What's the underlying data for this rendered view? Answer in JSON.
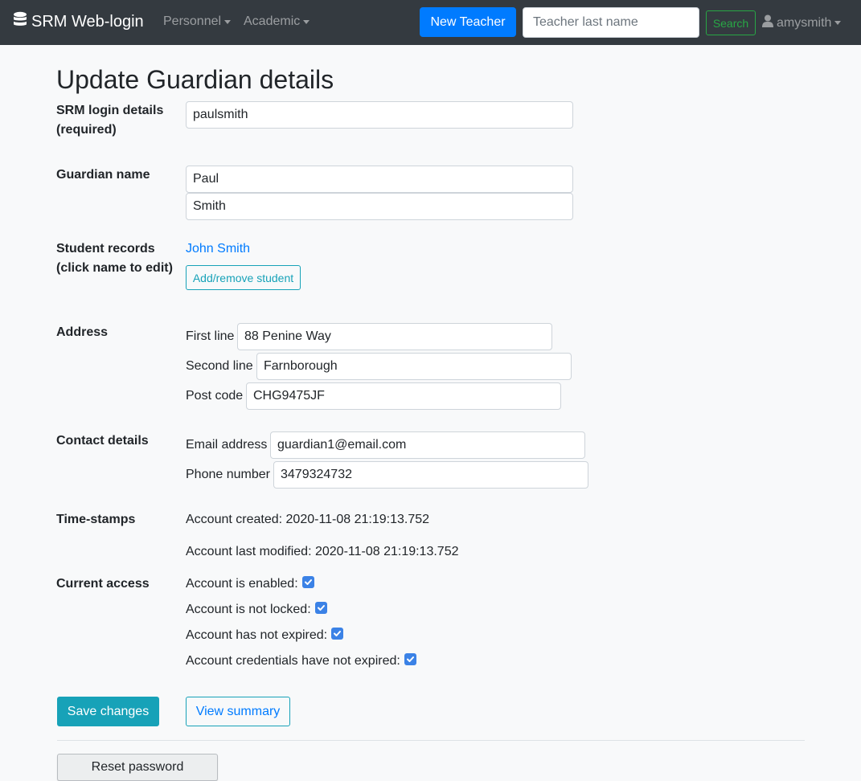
{
  "navbar": {
    "brand": "SRM Web-login",
    "menu_personnel": "Personnel",
    "menu_academic": "Academic",
    "new_teacher_label": "New Teacher",
    "search_placeholder": "Teacher last name",
    "search_label": "Search",
    "username": "amysmith",
    "brand_icon": "database-icon",
    "user_icon": "user-icon"
  },
  "page": {
    "title": "Update Guardian details"
  },
  "login": {
    "label": "SRM login details (required)",
    "username": "paulsmith"
  },
  "guardian": {
    "label": "Guardian name",
    "first_name": "Paul",
    "last_name": "Smith"
  },
  "students": {
    "label": "Student records (click name to edit)",
    "records": [
      "John Smith"
    ],
    "add_remove_label": "Add/remove student"
  },
  "address": {
    "label": "Address",
    "first_line_label": "First line",
    "first_line": "88 Penine Way",
    "second_line_label": "Second line",
    "second_line": "Farnborough",
    "post_code_label": "Post code",
    "post_code": "CHG9475JF"
  },
  "contact": {
    "label": "Contact details",
    "email_label": "Email address",
    "email": "guardian1@email.com",
    "phone_label": "Phone number",
    "phone": "3479324732"
  },
  "timestamps": {
    "label": "Time-stamps",
    "created": "Account created: 2020-11-08 21:19:13.752",
    "modified": "Account last modified: 2020-11-08 21:19:13.752"
  },
  "access": {
    "label": "Current access",
    "items": [
      {
        "text": "Account is enabled:",
        "checked": true
      },
      {
        "text": "Account is not locked:",
        "checked": true
      },
      {
        "text": "Account has not expired:",
        "checked": true
      },
      {
        "text": "Account credentials have not expired:",
        "checked": true
      }
    ]
  },
  "actions": {
    "save_label": "Save changes",
    "view_summary_label": "View summary",
    "reset_password_label": "Reset password"
  },
  "colors": {
    "navbar_bg": "#343a40",
    "primary": "#007bff",
    "info": "#17a2b8",
    "success": "#28a745"
  }
}
